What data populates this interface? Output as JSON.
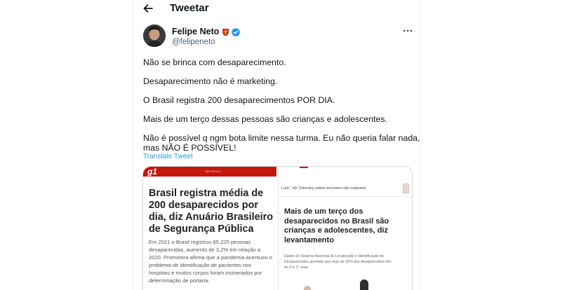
{
  "header": {
    "title": "Tweetar"
  },
  "tweet": {
    "author_name": "Felipe Neto",
    "handle": "@felipeneto",
    "lines": [
      "Não se brinca com desaparecimento.",
      "Desaparecimento não é marketing.",
      "O Brasil registra 200 desaparecimentos POR DIA.",
      "Mais de um terço dessas pessoas são crianças e adolescentes.",
      "Não é possível q ngm bota limite nessa turma. Eu não queria falar nada,",
      "mas NÃO É POSSÍVEL!"
    ],
    "translate_label": "Translate Tweet"
  },
  "media": {
    "left": {
      "logo": "g1",
      "section": "SÃO PAULO",
      "headline": "Brasil registra média de 200 desaparecidos por dia, diz Anuário Brasileiro de Segurança Pública",
      "subtitle": "Em 2021 o Brasil registrou 65.225 pessoas desaparecidas, aumento de 3,2% em relação a 2020. Promotora afirma que a pandemia acentuou o problema de identificação de pacientes nos hospitais e muitos corpos foram incinerados por determinação de portaria."
    },
    "right": {
      "caption": "Lula\", diz Zelensky sobre encontro não realizado",
      "headline": "Mais de um terço dos desaparecidos no Brasil são crianças e adolescentes, diz levantamento",
      "subtitle": "Dados do Sistema Nacional de Localização e Identificação de Desaparecidos apontam que mais de 35% dos desaparecidos têm de 0 a 17 anos"
    }
  },
  "colors": {
    "text": "#0f1419",
    "secondary": "#536471",
    "link": "#1d9bf0",
    "g1_red": "#c4170c"
  },
  "icons": {
    "back": "arrow-left-icon",
    "verified": "verified-badge-icon",
    "more": "more-horizontal-icon",
    "flag": "crest-emoji-icon"
  }
}
